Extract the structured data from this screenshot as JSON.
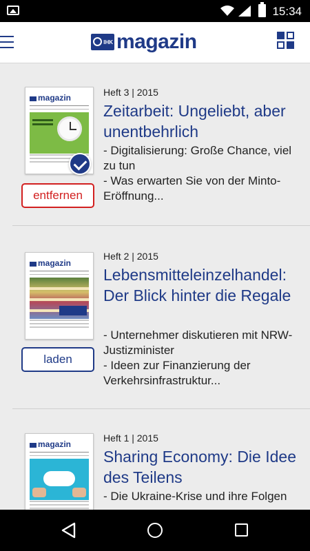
{
  "status_bar": {
    "time": "15:34"
  },
  "app_bar": {
    "logo_badge": "IHK",
    "logo_word": "magazin",
    "brand_color": "#1f3a87"
  },
  "issues": [
    {
      "meta": "Heft 3 | 2015",
      "title": "Zeitarbeit: Ungeliebt, aber unentbehrlich",
      "bullets": [
        "- Digitalisierung: Große Chance, viel zu tun",
        "- Was erwarten Sie von der Minto-Eröffnung..."
      ],
      "button_label": "entfernen",
      "downloaded": true,
      "cover_word": "magazin"
    },
    {
      "meta": "Heft 2 | 2015",
      "title": "Lebensmitteleinzelhandel: Der Blick hinter die Regale",
      "bullets": [
        "- Unternehmer diskutieren mit NRW-Justizminister",
        "- Ideen zur Finanzierung der Verkehrsinfrastruktur..."
      ],
      "button_label": "laden",
      "downloaded": false,
      "cover_word": "magazin"
    },
    {
      "meta": "Heft 1 | 2015",
      "title": "Sharing Economy: Die Idee des Teilens",
      "bullets": [
        "- Die Ukraine-Krise und ihre Folgen"
      ],
      "button_label": "",
      "downloaded": false,
      "cover_word": "magazin"
    }
  ],
  "colors": {
    "remove_button": "#d21f1f",
    "title_color": "#1f3a87",
    "background": "#ececec"
  }
}
